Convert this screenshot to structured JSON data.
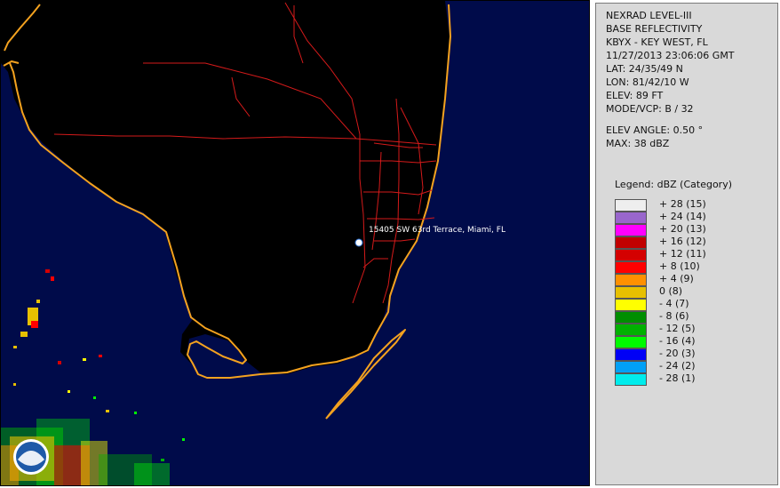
{
  "map": {
    "location_label": "15405 SW 63rd Terrace, Miami, FL",
    "colors": {
      "background": "#000b4a",
      "land": "#000000",
      "coastline": "#f4a21f",
      "roads": "#d41a1a",
      "marker": "#ffffff"
    }
  },
  "info": {
    "lines": [
      "NEXRAD LEVEL-III",
      "BASE REFLECTIVITY",
      "KBYX - KEY WEST, FL",
      "11/27/2013 23:06:06 GMT",
      "LAT: 24/35/49 N",
      "LON: 81/42/10 W",
      "ELEV: 89 FT",
      "MODE/VCP: B / 32"
    ],
    "elev_angle": "ELEV ANGLE: 0.50 °",
    "max": "MAX: 38 dBZ"
  },
  "legend": {
    "title": "Legend: dBZ (Category)",
    "entries": [
      {
        "label": "+ 28  (15)",
        "color": "#eeeeee"
      },
      {
        "label": "+ 24  (14)",
        "color": "#9966cc"
      },
      {
        "label": "+ 20  (13)",
        "color": "#ff00ff"
      },
      {
        "label": "+ 16  (12)",
        "color": "#c10000"
      },
      {
        "label": "+ 12  (11)",
        "color": "#d40000"
      },
      {
        "label": "+ 8  (10)",
        "color": "#ff0000"
      },
      {
        "label": "+ 4  (9)",
        "color": "#ff9000"
      },
      {
        "label": "0  (8)",
        "color": "#e7c000"
      },
      {
        "label": "- 4  (7)",
        "color": "#ffff00"
      },
      {
        "label": "- 8  (6)",
        "color": "#008e00"
      },
      {
        "label": "- 12  (5)",
        "color": "#01b101"
      },
      {
        "label": "- 16  (4)",
        "color": "#00fb00"
      },
      {
        "label": "- 20  (3)",
        "color": "#0000f6"
      },
      {
        "label": "- 24  (2)",
        "color": "#01a0f6"
      },
      {
        "label": "- 28  (1)",
        "color": "#00ecec"
      }
    ]
  },
  "logo": {
    "text": "NOAA"
  }
}
